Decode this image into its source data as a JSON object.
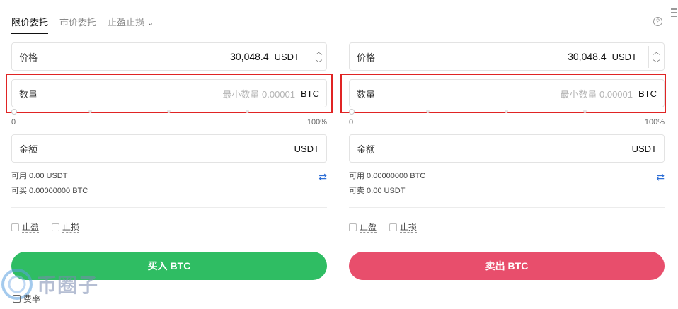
{
  "tabs": {
    "limit": "限价委托",
    "market": "市价委托",
    "stop": "止盈止损"
  },
  "help_icon": "?",
  "buy": {
    "price_label": "价格",
    "price_value": "30,048.4",
    "price_unit": "USDT",
    "qty_label": "数量",
    "qty_placeholder": "最小数量 0.00001",
    "qty_unit": "BTC",
    "slider_min": "0",
    "slider_max": "100%",
    "amount_label": "金额",
    "amount_unit": "USDT",
    "available": "可用 0.00 USDT",
    "can_trade": "可买 0.00000000 BTC",
    "take_profit": "止盈",
    "stop_loss": "止损",
    "button": "买入 BTC"
  },
  "sell": {
    "price_label": "价格",
    "price_value": "30,048.4",
    "price_unit": "USDT",
    "qty_label": "数量",
    "qty_placeholder": "最小数量 0.00001",
    "qty_unit": "BTC",
    "slider_min": "0",
    "slider_max": "100%",
    "amount_label": "金额",
    "amount_unit": "USDT",
    "available": "可用 0.00000000 BTC",
    "can_trade": "可卖 0.00 USDT",
    "take_profit": "止盈",
    "stop_loss": "止损",
    "button": "卖出 BTC"
  },
  "fee_label": "费率",
  "watermark": "币圈子",
  "colors": {
    "buy": "#2fbd63",
    "sell": "#e84e6c",
    "highlight": "#e02424",
    "swap": "#2f6fd6"
  },
  "icons": {
    "help": "help-icon",
    "step_up": "chevron-up-icon",
    "step_down": "chevron-down-icon",
    "swap": "swap-icon",
    "dropdown": "chevron-down-icon"
  }
}
